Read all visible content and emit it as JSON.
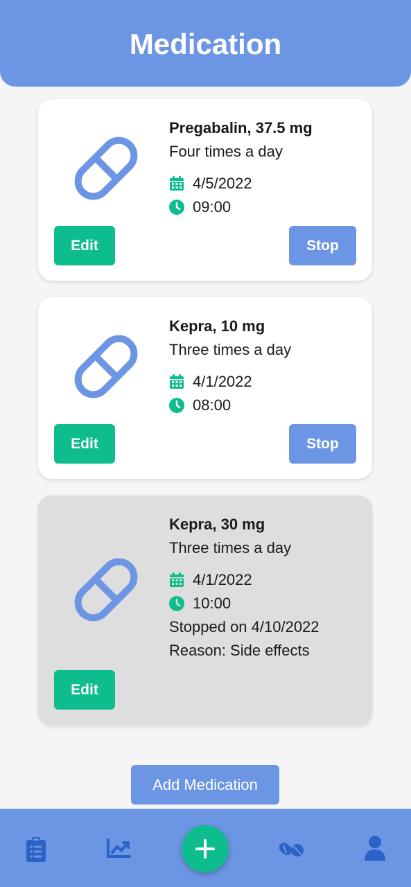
{
  "header": {
    "title": "Medication"
  },
  "colors": {
    "primary": "#6c95e3",
    "accent": "#0ebd8e",
    "stopped_card": "#dedede"
  },
  "medications": [
    {
      "name": "Pregabalin, 37.5 mg",
      "frequency": "Four times a day",
      "date": "4/5/2022",
      "time": "09:00",
      "edit_label": "Edit",
      "stop_label": "Stop",
      "icon": "pill-icon"
    },
    {
      "name": "Kepra, 10 mg",
      "frequency": "Three times a day",
      "date": "4/1/2022",
      "time": "08:00",
      "edit_label": "Edit",
      "stop_label": "Stop",
      "icon": "pill-icon"
    },
    {
      "name": "Kepra, 30 mg",
      "frequency": "Three times a day",
      "date": "4/1/2022",
      "time": "10:00",
      "stopped_text": "Stopped on 4/10/2022",
      "reason_text": "Reason: Side effects",
      "edit_label": "Edit",
      "icon": "pill-icon"
    }
  ],
  "add_button": {
    "label": "Add Medication"
  },
  "bottom_nav": {
    "items": [
      {
        "icon": "clipboard-icon"
      },
      {
        "icon": "chart-icon"
      },
      {
        "icon": "plus-icon"
      },
      {
        "icon": "pills-icon"
      },
      {
        "icon": "user-icon"
      }
    ]
  }
}
